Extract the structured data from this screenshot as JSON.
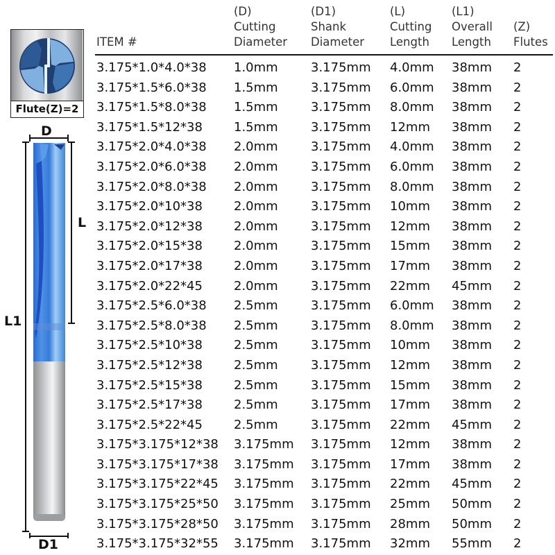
{
  "flute_icon": {
    "label": "Flute(Z)=2",
    "colors": {
      "dark_blue": "#1f3f70",
      "mid_blue": "#3f74b3",
      "light_blue": "#7fb0e0"
    }
  },
  "diagram": {
    "labels": {
      "d": "D",
      "l": "L",
      "l1": "L1",
      "d1": "D1"
    },
    "colors": {
      "coating_blue": "#3f86d8",
      "coating_dark": "#1e4fc0",
      "shank_gray": "#b8b9bb"
    }
  },
  "table": {
    "headers": [
      {
        "line1": "",
        "line2": "",
        "line3": "ITEM #"
      },
      {
        "line1": "(D)",
        "line2": "Cutting",
        "line3": "Diameter"
      },
      {
        "line1": "(D1)",
        "line2": "Shank",
        "line3": "Diameter"
      },
      {
        "line1": "(L)",
        "line2": "Cutting",
        "line3": "Length"
      },
      {
        "line1": "(L1)",
        "line2": "Overall",
        "line3": "Length"
      },
      {
        "line1": "",
        "line2": "(Z)",
        "line3": "Flutes"
      }
    ],
    "rows": [
      [
        "3.175*1.0*4.0*38",
        "1.0mm",
        "3.175mm",
        "4.0mm",
        "38mm",
        "2"
      ],
      [
        "3.175*1.5*6.0*38",
        "1.5mm",
        "3.175mm",
        "6.0mm",
        "38mm",
        "2"
      ],
      [
        "3.175*1.5*8.0*38",
        "1.5mm",
        "3.175mm",
        "8.0mm",
        "38mm",
        "2"
      ],
      [
        "3.175*1.5*12*38",
        "1.5mm",
        "3.175mm",
        "12mm",
        "38mm",
        "2"
      ],
      [
        "3.175*2.0*4.0*38",
        "2.0mm",
        "3.175mm",
        "4.0mm",
        "38mm",
        "2"
      ],
      [
        "3.175*2.0*6.0*38",
        "2.0mm",
        "3.175mm",
        "6.0mm",
        "38mm",
        "2"
      ],
      [
        "3.175*2.0*8.0*38",
        "2.0mm",
        "3.175mm",
        "8.0mm",
        "38mm",
        "2"
      ],
      [
        "3.175*2.0*10*38",
        "2.0mm",
        "3.175mm",
        "10mm",
        "38mm",
        "2"
      ],
      [
        "3.175*2.0*12*38",
        "2.0mm",
        "3.175mm",
        "12mm",
        "38mm",
        "2"
      ],
      [
        "3.175*2.0*15*38",
        "2.0mm",
        "3.175mm",
        "15mm",
        "38mm",
        "2"
      ],
      [
        "3.175*2.0*17*38",
        "2.0mm",
        "3.175mm",
        "17mm",
        "38mm",
        "2"
      ],
      [
        "3.175*2.0*22*45",
        "2.0mm",
        "3.175mm",
        "22mm",
        "45mm",
        "2"
      ],
      [
        "3.175*2.5*6.0*38",
        "2.5mm",
        "3.175mm",
        "6.0mm",
        "38mm",
        "2"
      ],
      [
        "3.175*2.5*8.0*38",
        "2.5mm",
        "3.175mm",
        "8.0mm",
        "38mm",
        "2"
      ],
      [
        "3.175*2.5*10*38",
        "2.5mm",
        "3.175mm",
        "10mm",
        "38mm",
        "2"
      ],
      [
        "3.175*2.5*12*38",
        "2.5mm",
        "3.175mm",
        "12mm",
        "38mm",
        "2"
      ],
      [
        "3.175*2.5*15*38",
        "2.5mm",
        "3.175mm",
        "15mm",
        "38mm",
        "2"
      ],
      [
        "3.175*2.5*17*38",
        "2.5mm",
        "3.175mm",
        "17mm",
        "38mm",
        "2"
      ],
      [
        "3.175*2.5*22*45",
        "2.5mm",
        "3.175mm",
        "22mm",
        "45mm",
        "2"
      ],
      [
        "3.175*3.175*12*38",
        "3.175mm",
        "3.175mm",
        "12mm",
        "38mm",
        "2"
      ],
      [
        "3.175*3.175*17*38",
        "3.175mm",
        "3.175mm",
        "17mm",
        "38mm",
        "2"
      ],
      [
        "3.175*3.175*22*45",
        "3.175mm",
        "3.175mm",
        "22mm",
        "45mm",
        "2"
      ],
      [
        "3.175*3.175*25*50",
        "3.175mm",
        "3.175mm",
        "25mm",
        "50mm",
        "2"
      ],
      [
        "3.175*3.175*28*50",
        "3.175mm",
        "3.175mm",
        "28mm",
        "50mm",
        "2"
      ],
      [
        "3.175*3.175*32*55",
        "3.175mm",
        "3.175mm",
        "32mm",
        "55mm",
        "2"
      ]
    ]
  }
}
